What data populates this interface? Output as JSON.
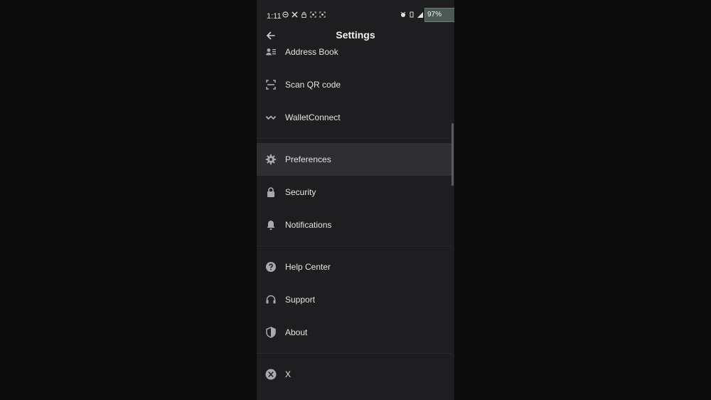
{
  "status_bar": {
    "time": "1:11",
    "battery": "97%",
    "left_icons": [
      "do-not-disturb-icon",
      "x-app-icon",
      "lock-icon",
      "scan-icon",
      "scan-icon"
    ],
    "right_icons": [
      "alarm-icon",
      "vibrate-icon",
      "signal-icon"
    ],
    "close_glyph": "✕"
  },
  "header": {
    "title": "Settings",
    "back_icon": "arrow-left-icon"
  },
  "menu": {
    "group1": [
      {
        "label": "Address Book",
        "icon": "contacts-icon"
      },
      {
        "label": "Scan QR code",
        "icon": "qr-scan-icon"
      },
      {
        "label": "WalletConnect",
        "icon": "walletconnect-icon"
      }
    ],
    "group2": [
      {
        "label": "Preferences",
        "icon": "gear-icon",
        "active": true
      },
      {
        "label": "Security",
        "icon": "lock-icon"
      },
      {
        "label": "Notifications",
        "icon": "bell-icon"
      }
    ],
    "group3": [
      {
        "label": "Help Center",
        "icon": "help-icon"
      },
      {
        "label": "Support",
        "icon": "headset-icon"
      },
      {
        "label": "About",
        "icon": "shield-icon"
      }
    ],
    "group4": [
      {
        "label": "X",
        "icon": "x-logo-icon"
      }
    ]
  },
  "colors": {
    "background": "#0c0c0c",
    "panel": "#1e1e21",
    "active_row": "#2e2e33",
    "text": "#e4e4e4",
    "icon": "#a8a8ae"
  }
}
